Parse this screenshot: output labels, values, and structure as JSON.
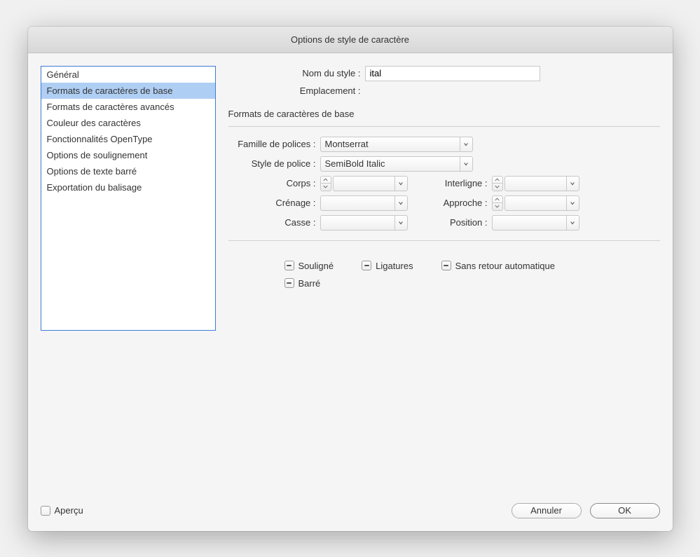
{
  "dialog": {
    "title": "Options de style de caractère"
  },
  "sidebar": {
    "items": [
      {
        "label": "Général",
        "selected": false
      },
      {
        "label": "Formats de caractères de base",
        "selected": true
      },
      {
        "label": "Formats de caractères avancés",
        "selected": false
      },
      {
        "label": "Couleur des caractères",
        "selected": false
      },
      {
        "label": "Fonctionnalités OpenType",
        "selected": false
      },
      {
        "label": "Options de soulignement",
        "selected": false
      },
      {
        "label": "Options de texte barré",
        "selected": false
      },
      {
        "label": "Exportation du balisage",
        "selected": false
      }
    ]
  },
  "header": {
    "style_name_label": "Nom du style :",
    "style_name_value": "ital",
    "location_label": "Emplacement :",
    "location_value": ""
  },
  "section": {
    "title": "Formats de caractères de base"
  },
  "form": {
    "font_family_label": "Famille de polices :",
    "font_family_value": "Montserrat",
    "font_style_label": "Style de police :",
    "font_style_value": "SemiBold Italic",
    "size_label": "Corps :",
    "size_value": "",
    "leading_label": "Interligne :",
    "leading_value": "",
    "kerning_label": "Crénage :",
    "kerning_value": "",
    "tracking_label": "Approche :",
    "tracking_value": "",
    "case_label": "Casse :",
    "case_value": "",
    "position_label": "Position :",
    "position_value": ""
  },
  "checkboxes": {
    "underline": "Souligné",
    "ligatures": "Ligatures",
    "no_break": "Sans retour automatique",
    "strikethrough": "Barré"
  },
  "footer": {
    "preview_label": "Aperçu",
    "cancel_label": "Annuler",
    "ok_label": "OK"
  }
}
